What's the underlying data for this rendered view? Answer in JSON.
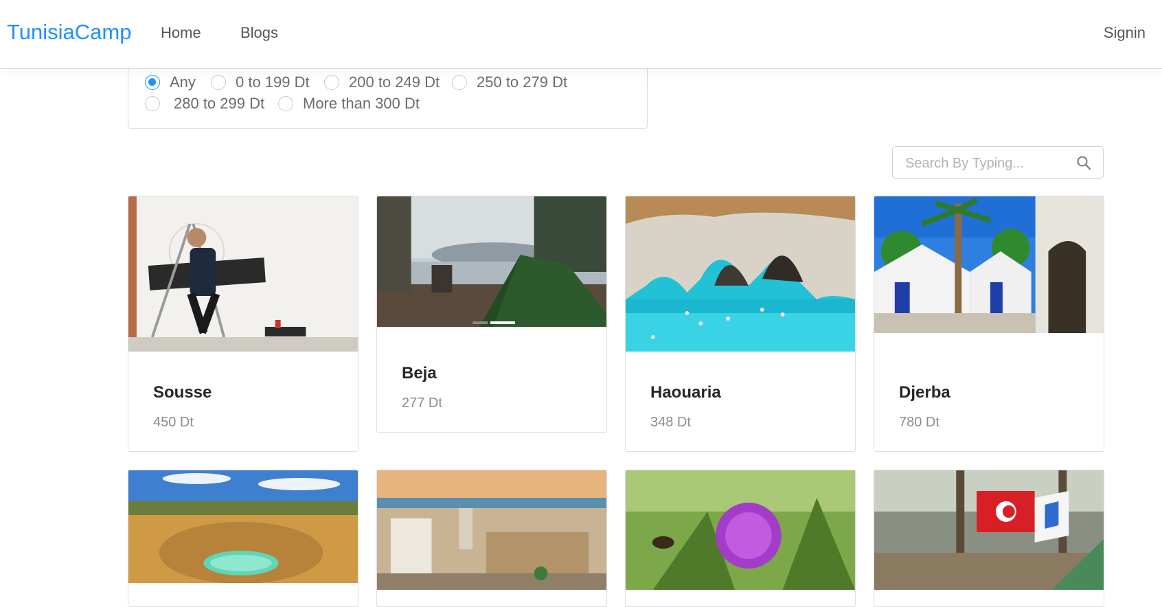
{
  "header": {
    "brand": "TunisiaCamp",
    "nav": {
      "home": "Home",
      "blogs": "Blogs",
      "signin": "Signin"
    }
  },
  "price_filter": {
    "options": [
      "Any",
      "0 to 199 Dt",
      "200 to 249 Dt",
      "250 to 279 Dt",
      "280 to 299 Dt",
      "More than 300 Dt"
    ],
    "selected": "Any"
  },
  "search": {
    "placeholder": "Search By Typing..."
  },
  "icons": {
    "search": "search-icon"
  },
  "colors": {
    "accent": "#1e90ff"
  },
  "destinations": [
    {
      "title": "Sousse",
      "price": "450 Dt"
    },
    {
      "title": "Beja",
      "price": "277 Dt"
    },
    {
      "title": "Haouaria",
      "price": "348 Dt"
    },
    {
      "title": "Djerba",
      "price": "780 Dt"
    }
  ]
}
